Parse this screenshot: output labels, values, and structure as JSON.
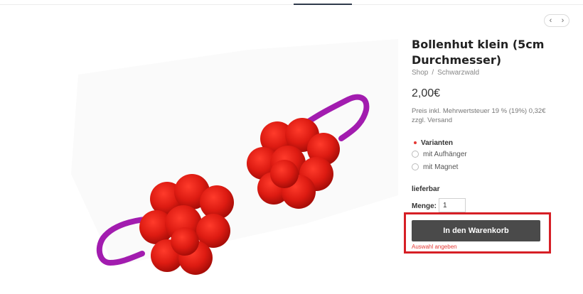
{
  "product": {
    "title": "Bollenhut klein (5cm Durchmesser)",
    "breadcrumb": [
      "Shop",
      "Schwarzwald"
    ],
    "breadcrumb_sep": "/",
    "price": "2,00€",
    "tax_note": "Preis inkl. Mehrwertsteuer 19 % (19%) 0,32€ zzgl. Versand",
    "image_alt": "Bollenhut klein"
  },
  "pager": {
    "prev": "‹",
    "next": "›"
  },
  "variants": {
    "heading": "Varianten",
    "options": [
      "mit Aufhänger",
      "mit Magnet"
    ]
  },
  "availability": "lieferbar",
  "quantity": {
    "label": "Menge:",
    "value": "1"
  },
  "cart": {
    "button_label": "In den Warenkorb",
    "hint": "Auswahl angeben"
  },
  "colors": {
    "button": "#4a4a4a",
    "highlight": "#d61f26",
    "ribbon": "#a21caf",
    "pompom": "#dd1b12",
    "error": "#e53935"
  }
}
